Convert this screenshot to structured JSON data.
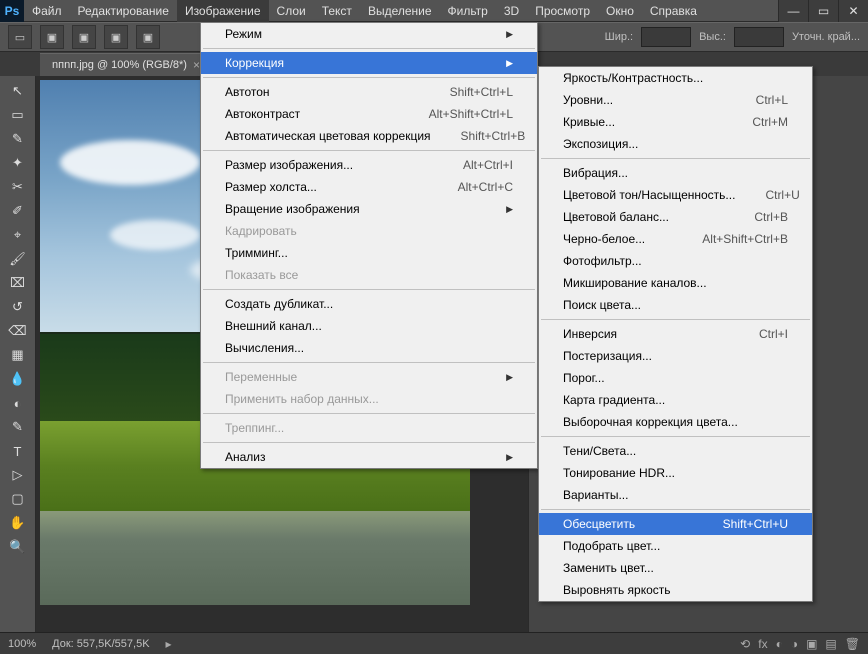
{
  "menubar": {
    "items": [
      "Файл",
      "Редактирование",
      "Изображение",
      "Слои",
      "Текст",
      "Выделение",
      "Фильтр",
      "3D",
      "Просмотр",
      "Окно",
      "Справка"
    ],
    "active_index": 2
  },
  "toolbar": {
    "width_label": "Шир.:",
    "height_label": "Выс.:",
    "refine_label": "Уточн. край..."
  },
  "document": {
    "tab_title": "nпnп.jpg @ 100% (RGB/8*)"
  },
  "status": {
    "zoom": "100%",
    "doc_info": "Док: 557,5K/557,5K"
  },
  "menu_image": [
    {
      "label": "Режим",
      "submenu": true
    },
    {
      "sep": true
    },
    {
      "label": "Коррекция",
      "submenu": true,
      "highlight": true
    },
    {
      "sep": true
    },
    {
      "label": "Автотон",
      "shortcut": "Shift+Ctrl+L"
    },
    {
      "label": "Автоконтраст",
      "shortcut": "Alt+Shift+Ctrl+L"
    },
    {
      "label": "Автоматическая цветовая коррекция",
      "shortcut": "Shift+Ctrl+B"
    },
    {
      "sep": true
    },
    {
      "label": "Размер изображения...",
      "shortcut": "Alt+Ctrl+I"
    },
    {
      "label": "Размер холста...",
      "shortcut": "Alt+Ctrl+C"
    },
    {
      "label": "Вращение изображения",
      "submenu": true
    },
    {
      "label": "Кадрировать",
      "disabled": true
    },
    {
      "label": "Тримминг..."
    },
    {
      "label": "Показать все",
      "disabled": true
    },
    {
      "sep": true
    },
    {
      "label": "Создать дубликат..."
    },
    {
      "label": "Внешний канал..."
    },
    {
      "label": "Вычисления..."
    },
    {
      "sep": true
    },
    {
      "label": "Переменные",
      "submenu": true,
      "disabled": true
    },
    {
      "label": "Применить набор данных...",
      "disabled": true
    },
    {
      "sep": true
    },
    {
      "label": "Треппинг...",
      "disabled": true
    },
    {
      "sep": true
    },
    {
      "label": "Анализ",
      "submenu": true
    }
  ],
  "menu_adjustments": [
    {
      "label": "Яркость/Контрастность..."
    },
    {
      "label": "Уровни...",
      "shortcut": "Ctrl+L"
    },
    {
      "label": "Кривые...",
      "shortcut": "Ctrl+M"
    },
    {
      "label": "Экспозиция..."
    },
    {
      "sep": true
    },
    {
      "label": "Вибрация..."
    },
    {
      "label": "Цветовой тон/Насыщенность...",
      "shortcut": "Ctrl+U"
    },
    {
      "label": "Цветовой баланс...",
      "shortcut": "Ctrl+B"
    },
    {
      "label": "Черно-белое...",
      "shortcut": "Alt+Shift+Ctrl+B"
    },
    {
      "label": "Фотофильтр..."
    },
    {
      "label": "Микширование каналов..."
    },
    {
      "label": "Поиск цвета..."
    },
    {
      "sep": true
    },
    {
      "label": "Инверсия",
      "shortcut": "Ctrl+I"
    },
    {
      "label": "Постеризация..."
    },
    {
      "label": "Порог..."
    },
    {
      "label": "Карта градиента..."
    },
    {
      "label": "Выборочная коррекция цвета..."
    },
    {
      "sep": true
    },
    {
      "label": "Тени/Света..."
    },
    {
      "label": "Тонирование HDR..."
    },
    {
      "label": "Варианты..."
    },
    {
      "sep": true
    },
    {
      "label": "Обесцветить",
      "shortcut": "Shift+Ctrl+U",
      "highlight": true
    },
    {
      "label": "Подобрать цвет..."
    },
    {
      "label": "Заменить цвет..."
    },
    {
      "label": "Выровнять яркость"
    }
  ]
}
